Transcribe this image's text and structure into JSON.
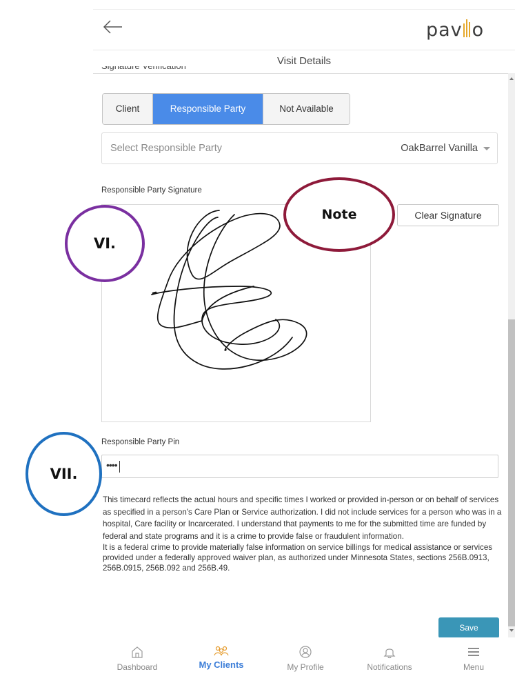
{
  "header": {
    "brand": "pavillio",
    "page_title": "Visit Details",
    "clipped_section_title": "Signature Verification"
  },
  "signature_verification": {
    "tabs": [
      {
        "label": "Client",
        "selected": false
      },
      {
        "label": "Responsible Party",
        "selected": true
      },
      {
        "label": "Not Available",
        "selected": false
      }
    ],
    "responsible_party_select": {
      "placeholder": "Select Responsible Party",
      "value": "OakBarrel Vanilla"
    },
    "signature_label": "Responsible Party Signature",
    "clear_button": "Clear Signature",
    "pin_label": "Responsible Party Pin",
    "pin_value": "••••"
  },
  "legal": {
    "paragraph1": "This timecard reflects the actual hours and specific times I worked or provided in-person or on behalf of services as specified in a person's Care Plan or Service authorization. I did not include services for a person who was in a hospital, Care facility or Incarcerated. I understand that payments to me for the submitted time are funded by federal and state programs and it is a crime to provide false or fraudulent information.",
    "paragraph2": "It is a federal crime to provide materially false information on service billings for medical assistance or services provided under a federally approved waiver plan, as authorized under Minnesota States, sections 256B.0913, 256B.0915, 256B.092 and 256B.49."
  },
  "actions": {
    "save": "Save"
  },
  "bottom_nav": [
    {
      "label": "Dashboard",
      "icon": "home-icon",
      "active": false
    },
    {
      "label": "My Clients",
      "icon": "clients-icon",
      "active": true
    },
    {
      "label": "My Profile",
      "icon": "profile-icon",
      "active": false
    },
    {
      "label": "Notifications",
      "icon": "bell-icon",
      "active": false
    },
    {
      "label": "Menu",
      "icon": "hamburger-icon",
      "active": false
    }
  ],
  "annotations": {
    "vi": "VI.",
    "note": "Note",
    "vii": "VII."
  },
  "colors": {
    "accent_blue": "#4a8be8",
    "save_button": "#3a96b7",
    "brand_bars": "#e5a82a",
    "nav_active": "#3b7dd8",
    "annotation_purple": "#7a2fa0",
    "annotation_maroon": "#8e1a3a",
    "annotation_blue": "#1f71c0"
  }
}
